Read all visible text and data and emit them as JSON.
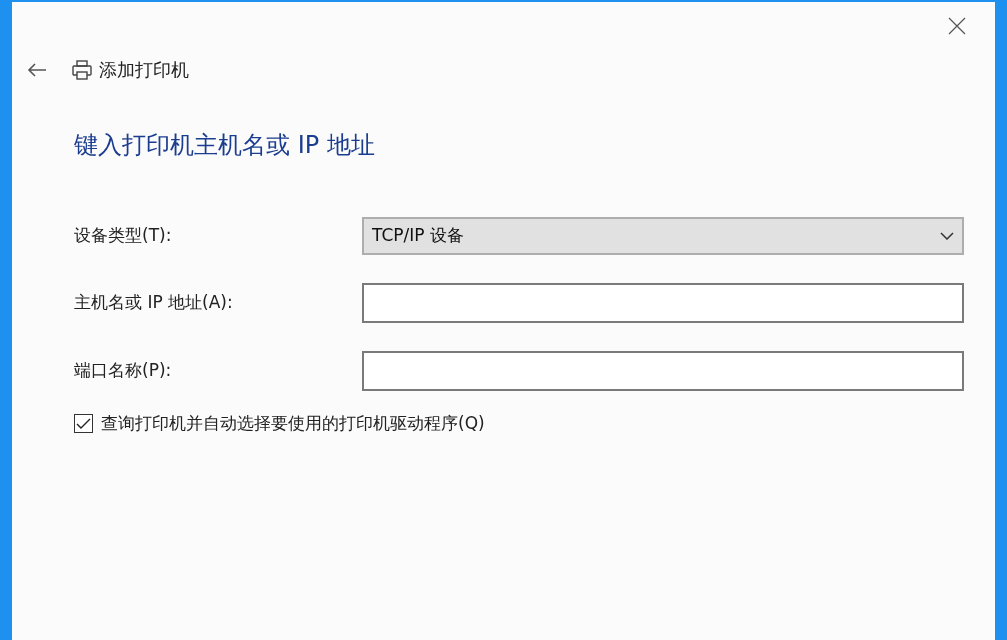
{
  "window": {
    "title": "添加打印机"
  },
  "heading": "键入打印机主机名或 IP 地址",
  "fields": [
    {
      "kind": "dropdown",
      "label": "设备类型(T):",
      "value": "TCP/IP 设备"
    },
    {
      "kind": "text",
      "label": "主机名或 IP 地址(A):"
    },
    {
      "kind": "text",
      "label": "端口名称(P):"
    }
  ],
  "query_printer": {
    "label": "查询打印机并自动选择要使用的打印机驱动程序(Q)",
    "checked": true
  }
}
